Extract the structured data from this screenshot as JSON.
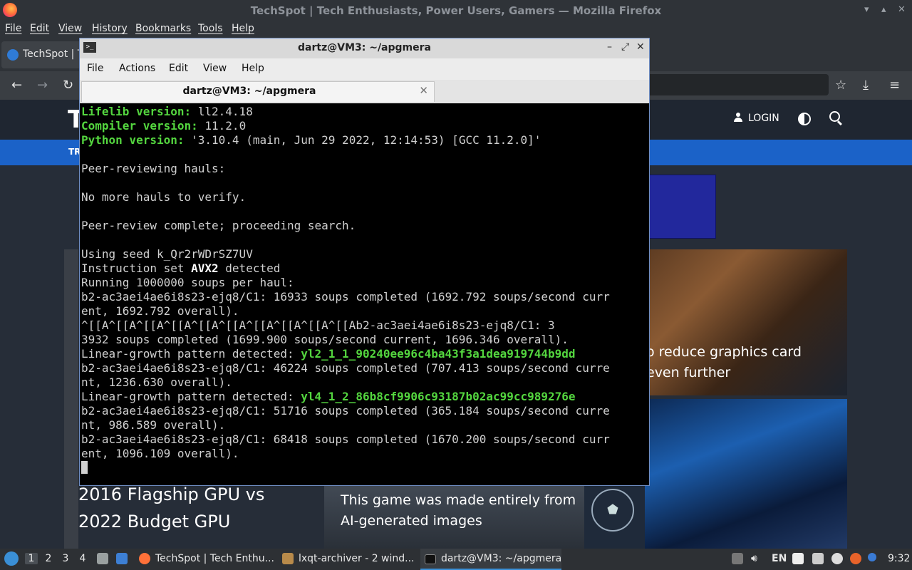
{
  "firefox": {
    "window_title": "TechSpot | Tech Enthusiasts, Power Users, Gamers — Mozilla Firefox",
    "menu": [
      "File",
      "Edit",
      "View",
      "History",
      "Bookmarks",
      "Tools",
      "Help"
    ],
    "tab_label": "TechSpot | T"
  },
  "techspot": {
    "logo": "T",
    "login_label": "LOGIN",
    "nav_fragment": "TR",
    "card_gpu_headline": "o reduce graphics card\neven further",
    "card_mid_headline": "This game was made entirely from\nAI-generated images",
    "left_headline": "2016 Flagship GPU vs\n2022 Budget GPU"
  },
  "terminal": {
    "window_title": "dartz@VM3: ~/apgmera",
    "menu": [
      "File",
      "Actions",
      "Edit",
      "View",
      "Help"
    ],
    "tab_label": "dartz@VM3: ~/apgmera",
    "lines": [
      [
        {
          "t": "Lifelib version:",
          "c": "g"
        },
        {
          "t": " ll2.4.18"
        }
      ],
      [
        {
          "t": "Compiler version:",
          "c": "g"
        },
        {
          "t": " 11.2.0"
        }
      ],
      [
        {
          "t": "Python version:",
          "c": "g"
        },
        {
          "t": " '3.10.4 (main, Jun 29 2022, 12:14:53) [GCC 11.2.0]'"
        }
      ],
      [
        {
          "t": ""
        }
      ],
      [
        {
          "t": "Peer-reviewing hauls:"
        }
      ],
      [
        {
          "t": ""
        }
      ],
      [
        {
          "t": "No more hauls to verify."
        }
      ],
      [
        {
          "t": ""
        }
      ],
      [
        {
          "t": "Peer-review complete; proceeding search."
        }
      ],
      [
        {
          "t": ""
        }
      ],
      [
        {
          "t": "Using seed k_Qr2rWDrSZ7UV"
        }
      ],
      [
        {
          "t": "Instruction set "
        },
        {
          "t": "AVX2",
          "c": "w"
        },
        {
          "t": " detected"
        }
      ],
      [
        {
          "t": "Running 1000000 soups per haul:"
        }
      ],
      [
        {
          "t": "b2-ac3aei4ae6i8s23-ejq8/C1: 16933 soups completed (1692.792 soups/second curr"
        }
      ],
      [
        {
          "t": "ent, 1692.792 overall)."
        }
      ],
      [
        {
          "t": "^[[A^[[A^[[A^[[A^[[A^[[A^[[A^[[A^[[A^[[Ab2-ac3aei4ae6i8s23-ejq8/C1: 3"
        }
      ],
      [
        {
          "t": "3932 soups completed (1699.900 soups/second current, 1696.346 overall)."
        }
      ],
      [
        {
          "t": "Linear-growth pattern detected: "
        },
        {
          "t": "yl2_1_1_90240ee96c4ba43f3a1dea919744b9dd",
          "c": "gh"
        }
      ],
      [
        {
          "t": "b2-ac3aei4ae6i8s23-ejq8/C1: 46224 soups completed (707.413 soups/second curre"
        }
      ],
      [
        {
          "t": "nt, 1236.630 overall)."
        }
      ],
      [
        {
          "t": "Linear-growth pattern detected: "
        },
        {
          "t": "yl4_1_2_86b8cf9906c93187b02ac99cc989276e",
          "c": "gh"
        }
      ],
      [
        {
          "t": "b2-ac3aei4ae6i8s23-ejq8/C1: 51716 soups completed (365.184 soups/second curre"
        }
      ],
      [
        {
          "t": "nt, 986.589 overall)."
        }
      ],
      [
        {
          "t": "b2-ac3aei4ae6i8s23-ejq8/C1: 68418 soups completed (1670.200 soups/second curr"
        }
      ],
      [
        {
          "t": "ent, 1096.109 overall)."
        }
      ]
    ]
  },
  "taskbar": {
    "workspaces": [
      "1",
      "2",
      "3",
      "4"
    ],
    "tasks": [
      "TechSpot | Tech Enthu...",
      "lxqt-archiver - 2 wind...",
      "dartz@VM3: ~/apgmera"
    ],
    "keyboard_layout": "EN",
    "clock": "9:32"
  }
}
